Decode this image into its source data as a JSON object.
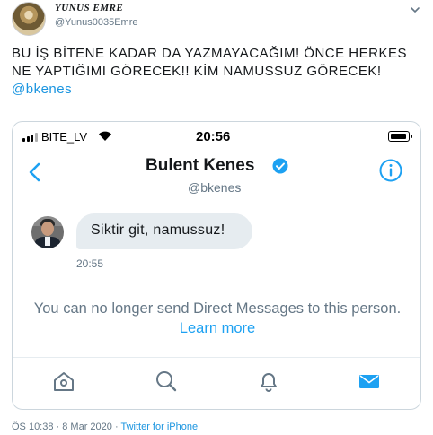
{
  "tweet": {
    "author_name": "YUNUS EMRE",
    "author_handle": "@Yunus0035Emre",
    "text": "BU İŞ BİTENE KADAR DA YAZMAYACAĞIM! ÖNCE HERKES NE YAPTIĞIMI GÖRECEK!! KİM NAMUSSUZ GÖRECEK!",
    "mention": "@bkenes",
    "timestamp": "ÖS 10:38 · 8 Mar 2020 · ",
    "source": "Twitter for iPhone",
    "menu_icon": "chevron-down-icon"
  },
  "screenshot": {
    "status_bar": {
      "carrier": "BITE_LV",
      "time": "20:56"
    },
    "header": {
      "name": "Bulent Kenes",
      "handle": "@bkenes",
      "verified_color": "#1da1f2"
    },
    "message": {
      "text": "Siktir git, namussuz!",
      "time": "20:55"
    },
    "notice": {
      "text": "You can no longer send Direct Messages to this person.",
      "link": "Learn more"
    },
    "tabs": [
      "home-icon",
      "search-icon",
      "bell-icon",
      "mail-icon"
    ],
    "accent_color": "#1da1f2"
  }
}
